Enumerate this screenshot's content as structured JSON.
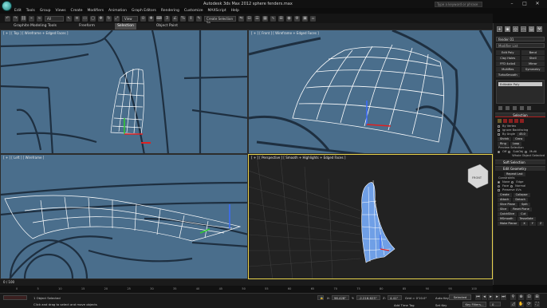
{
  "title_bar": {
    "title": "Autodesk 3ds Max 2012   sphere fenders.max",
    "search_placeholder": "Type a keyword or phrase",
    "minimize": "–",
    "maximize": "□",
    "close": "✕"
  },
  "menubar": {
    "items": [
      "Edit",
      "Tools",
      "Group",
      "Views",
      "Create",
      "Modifiers",
      "Animation",
      "Graph Editors",
      "Rendering",
      "Customize",
      "MAXScript",
      "Help"
    ]
  },
  "toolbar": {
    "selection_filter": "All",
    "view_dropdown": "View",
    "selection_set": "Create Selection Se"
  },
  "ribbon": {
    "tabs": [
      "Graphite Modeling Tools",
      "Freeform",
      "Selection",
      "Object Paint"
    ],
    "active_index": 2
  },
  "viewports": {
    "top": {
      "label": "[ + ] [ Top ] [ Wireframe + Edged Faces ]"
    },
    "front": {
      "label": "[ + ] [ Front ] [ Wireframe + Edged Faces ]"
    },
    "left": {
      "label": "[ + ] [ Left ] [ Wireframe ]"
    },
    "perspective": {
      "label": "[ + ] [ Perspective ] [ Smooth + Highlights + Edged Faces ]",
      "viewcube": "FRONT"
    }
  },
  "command_panel": {
    "tabs": [
      "+",
      "▣",
      "◎",
      "▭",
      "▤",
      "⚒"
    ],
    "object_name": "fender 01",
    "modifier_list": "Modifier List",
    "modifier_buttons": [
      "Edit Poly",
      "Bend",
      "Clay Holes",
      "Shell",
      "FFD 4x4x4",
      "Mirror",
      "MultiRes",
      "Symmetry",
      "TurboSmooth"
    ],
    "stack_item": "Editable Poly",
    "rollouts": {
      "selection": "Selection",
      "soft_selection": "Soft Selection",
      "edit_geometry": "Edit Geometry"
    },
    "selection_text": {
      "by_vertex": "By Vertex",
      "ignore_backfacing": "Ignore Backfacing",
      "by_angle": "By Angle",
      "angle_value": "45.0",
      "shrink": "Shrink",
      "grow": "Grow",
      "ring": "Ring",
      "loop": "Loop",
      "preview_selection": "Preview Selection",
      "off": "Off",
      "subobj": "SubObj",
      "multi": "Multi",
      "whole_object": "Whole Object Selected"
    },
    "edit_geometry_text": {
      "repeat_last": "Repeat Last",
      "constraints": "Constraints",
      "none": "None",
      "edge": "Edge",
      "face": "Face",
      "normal": "Normal",
      "preserve_uvs": "Preserve UVs",
      "create": "Create",
      "collapse": "Collapse",
      "attach": "Attach",
      "detach": "Detach",
      "slice_plane": "Slice Plane",
      "split": "Split",
      "slice": "Slice",
      "reset_plane": "Reset Plane",
      "quickslice": "QuickSlice",
      "cut": "Cut",
      "msmooth": "MSmooth",
      "tessellate": "Tessellate",
      "make_planar": "Make Planar",
      "x": "X",
      "y": "Y",
      "z": "Z"
    }
  },
  "timeline": {
    "frame": "0 / 100",
    "ticks": [
      "0",
      "5",
      "10",
      "15",
      "20",
      "25",
      "30",
      "35",
      "40",
      "45",
      "50",
      "55",
      "60",
      "65",
      "70",
      "75",
      "80",
      "85",
      "90",
      "95",
      "100"
    ]
  },
  "status": {
    "selected": "1 Object Selected",
    "prompt": "Click and drag to select and move objects",
    "x_label": "X:",
    "x_value": "96.428\"",
    "y_label": "Y:",
    "y_value": "-2.216.623\"",
    "z_label": "Z:",
    "z_value": "4.41\"",
    "grid": "Grid = 0'10.0\"",
    "auto_key": "Auto Key",
    "auto_key_value": "Selected",
    "set_key": "Set Key",
    "key_filters": "Key Filters...",
    "add_time_tag": "Add Time Tag",
    "frame_field": "0"
  },
  "colors": {
    "viewport_bg": "#4a6e8c",
    "viewport_lines": "#1e2f40",
    "wire_white": "#ffffff",
    "mesh_blue": "#6f9fe6",
    "perspective_bg": "#222222",
    "active_border": "#e7d24b"
  }
}
